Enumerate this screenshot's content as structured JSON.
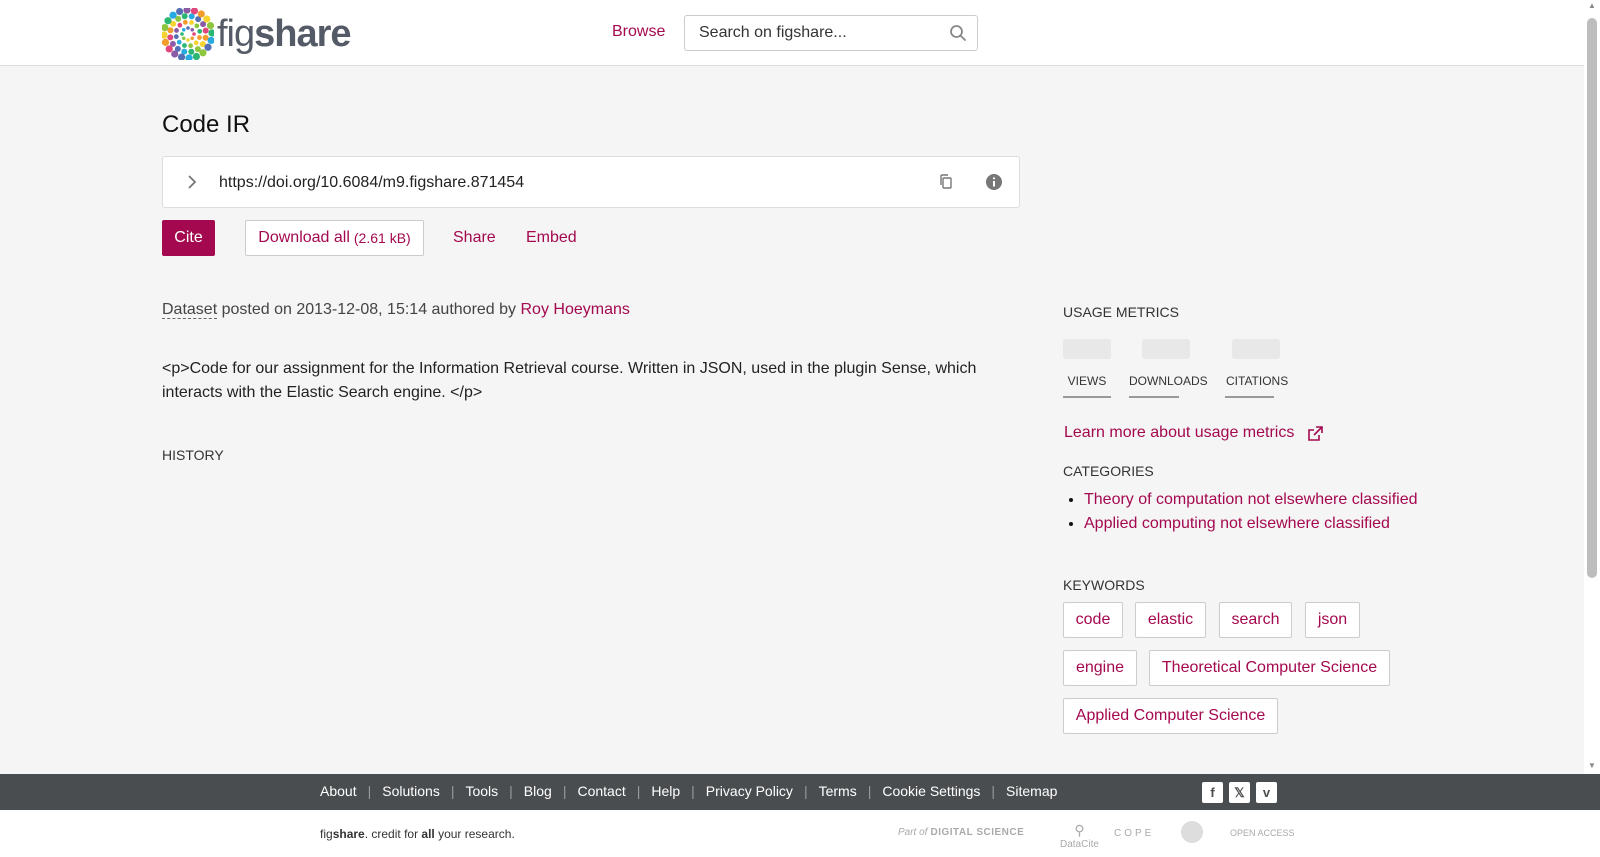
{
  "header": {
    "logo_text_light": "fig",
    "logo_text_bold": "share",
    "browse_label": "Browse",
    "search_placeholder": "Search on figshare..."
  },
  "item": {
    "title": "Code IR",
    "doi_url": "https://doi.org/10.6084/m9.figshare.871454",
    "cite_label": "Cite",
    "download_label": "Download all",
    "download_size": "(2.61 kB)",
    "share_label": "Share",
    "embed_label": "Embed",
    "type": "Dataset",
    "posted_text": " posted on 2013-12-08, 15:14 authored by ",
    "author": "Roy Hoeymans",
    "description": "<p>Code for our assignment for the Information Retrieval course. Written in JSON, used in the plugin Sense, which interacts with the Elastic Search engine. </p>",
    "history_heading": "HISTORY"
  },
  "sidebar": {
    "usage_heading": "USAGE METRICS",
    "metrics": [
      {
        "label": "VIEWS"
      },
      {
        "label": "DOWNLOADS"
      },
      {
        "label": "CITATIONS"
      }
    ],
    "learn_more": "Learn more about usage metrics",
    "categories_heading": "CATEGORIES",
    "categories": [
      "Theory of computation not elsewhere classified",
      "Applied computing not elsewhere classified"
    ],
    "keywords_heading": "KEYWORDS",
    "keywords": [
      "code",
      "elastic",
      "search",
      "json",
      "engine",
      "Theoretical Computer Science",
      "Applied Computer Science"
    ]
  },
  "footer": {
    "links": [
      "About",
      "Solutions",
      "Tools",
      "Blog",
      "Contact",
      "Help",
      "Privacy Policy",
      "Terms",
      "Cookie Settings",
      "Sitemap"
    ],
    "tagline_fig": "fig",
    "tagline_share": "share",
    "tagline_mid": ". credit for ",
    "tagline_all": "all",
    "tagline_end": " your research.",
    "partners": {
      "part_of": "Part of",
      "digital_science": "DIGITAL SCIENCE",
      "datacite": "DataCite",
      "cope": "COPE",
      "open_access": "OPEN ACCESS"
    }
  },
  "colors": {
    "accent": "#a4094f",
    "footer_dark": "#4a4d4f"
  }
}
